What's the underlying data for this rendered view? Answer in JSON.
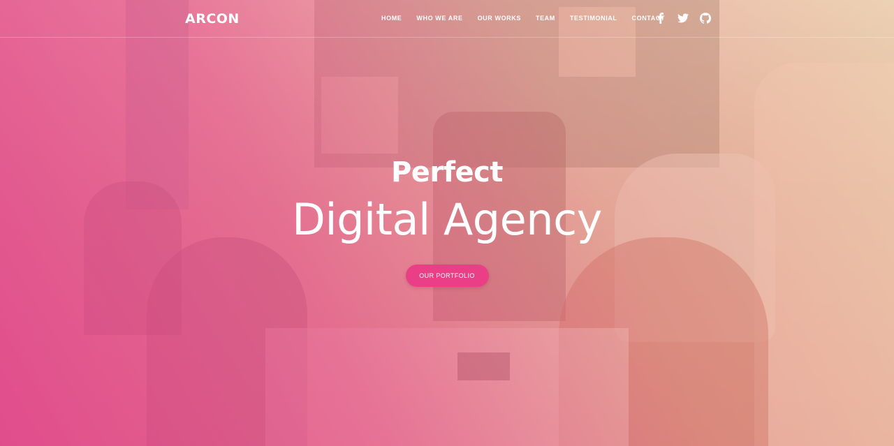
{
  "brand": {
    "name": "ARCON"
  },
  "nav": {
    "items": [
      "HOME",
      "WHO WE ARE",
      "OUR WORKS",
      "TEAM",
      "TESTIMONIAL",
      "CONTACT"
    ]
  },
  "social": [
    "facebook-icon",
    "twitter-icon",
    "github-icon"
  ],
  "hero": {
    "kicker": "Perfect",
    "title": "Digital Agency",
    "cta_label": "OUR PORTFOLIO"
  },
  "colors": {
    "accent": "#ea3f86",
    "overlay_start": "#e2468c",
    "overlay_end": "#f0c896",
    "text": "#ffffff"
  }
}
